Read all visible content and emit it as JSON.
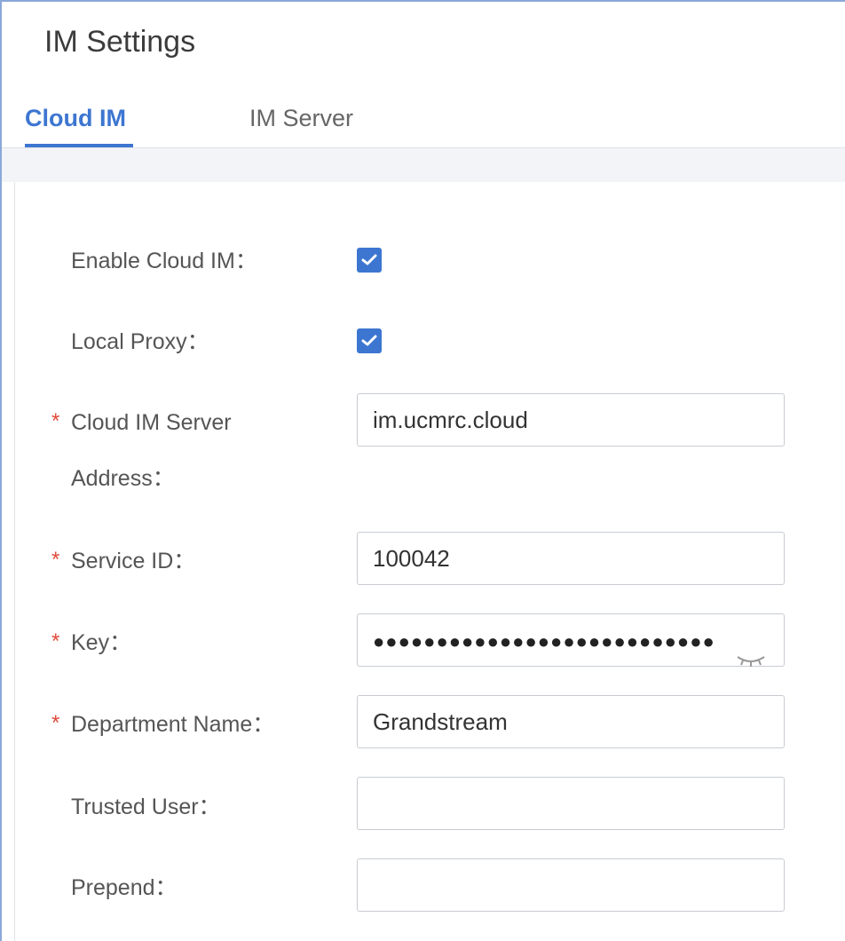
{
  "header": {
    "title": "IM Settings"
  },
  "tabs": [
    {
      "label": "Cloud IM",
      "active": true
    },
    {
      "label": "IM Server",
      "active": false
    }
  ],
  "form": {
    "enable_cloud_im": {
      "label": "Enable Cloud IM：",
      "checked": true
    },
    "local_proxy": {
      "label": "Local Proxy：",
      "checked": true
    },
    "cloud_im_server": {
      "required_mark": "*",
      "label_line1": "Cloud IM Server",
      "label_line2": "Address：",
      "value": "im.ucmrc.cloud"
    },
    "service_id": {
      "required_mark": "*",
      "label": "Service ID：",
      "value": "100042"
    },
    "key": {
      "required_mark": "*",
      "label": "Key：",
      "masked_value": "●●●●●●●●●●●●●●●●●●●●●●●●●●●",
      "icon": "eye-closed-icon"
    },
    "department_name": {
      "required_mark": "*",
      "label": "Department Name：",
      "value": "Grandstream"
    },
    "trusted_user": {
      "label": "Trusted User：",
      "value": ""
    },
    "prepend": {
      "label": "Prepend：",
      "value": ""
    }
  },
  "colors": {
    "accent": "#3d76d1",
    "required": "#e04a3a",
    "band": "#f2f4f7"
  }
}
